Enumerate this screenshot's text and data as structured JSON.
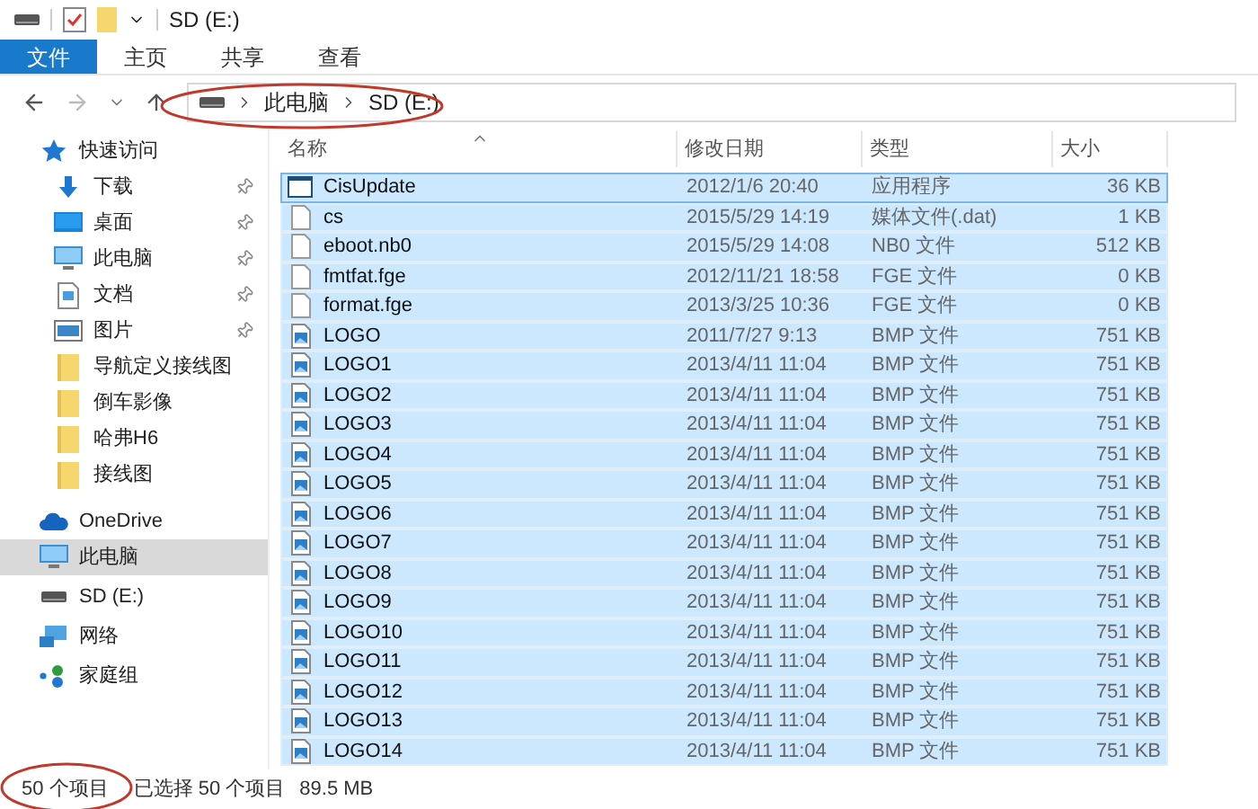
{
  "window": {
    "title": "SD (E:)"
  },
  "ribbon_tabs": [
    {
      "label": "文件",
      "selected": true
    },
    {
      "label": "主页",
      "selected": false
    },
    {
      "label": "共享",
      "selected": false
    },
    {
      "label": "查看",
      "selected": false
    }
  ],
  "address_bar": {
    "crumbs": [
      "此电脑",
      "SD (E:)"
    ]
  },
  "sidebar": {
    "items": [
      {
        "label": "快速访问",
        "kind": "star",
        "selected": false,
        "children": [
          {
            "label": "下载",
            "kind": "download",
            "pinned": true
          },
          {
            "label": "桌面",
            "kind": "desktop",
            "pinned": true
          },
          {
            "label": "此电脑",
            "kind": "computer",
            "pinned": true
          },
          {
            "label": "文档",
            "kind": "document",
            "pinned": true
          },
          {
            "label": "图片",
            "kind": "pictures",
            "pinned": true
          },
          {
            "label": "导航定义接线图",
            "kind": "folder",
            "pinned": false
          },
          {
            "label": "倒车影像",
            "kind": "folder",
            "pinned": false
          },
          {
            "label": "哈弗H6",
            "kind": "folder",
            "pinned": false
          },
          {
            "label": "接线图",
            "kind": "folder",
            "pinned": false
          }
        ]
      },
      {
        "label": "OneDrive",
        "kind": "cloud",
        "selected": false
      },
      {
        "label": "此电脑",
        "kind": "computer",
        "selected": true
      },
      {
        "label": "SD (E:)",
        "kind": "drive",
        "selected": false
      },
      {
        "label": "网络",
        "kind": "network",
        "selected": false
      },
      {
        "label": "家庭组",
        "kind": "homegroup",
        "selected": false
      }
    ]
  },
  "table": {
    "columns": [
      "名称",
      "修改日期",
      "类型",
      "大小"
    ],
    "rows": [
      {
        "name": "CisUpdate",
        "date": "2012/1/6 20:40",
        "type": "应用程序",
        "size": "36 KB",
        "kind": "app",
        "selected": true,
        "focused": true
      },
      {
        "name": "cs",
        "date": "2015/5/29 14:19",
        "type": "媒体文件(.dat)",
        "size": "1 KB",
        "kind": "file",
        "selected": true,
        "focused": false
      },
      {
        "name": "eboot.nb0",
        "date": "2015/5/29 14:08",
        "type": "NB0 文件",
        "size": "512 KB",
        "kind": "file",
        "selected": true,
        "focused": false
      },
      {
        "name": "fmtfat.fge",
        "date": "2012/11/21 18:58",
        "type": "FGE 文件",
        "size": "0 KB",
        "kind": "file",
        "selected": true,
        "focused": false
      },
      {
        "name": "format.fge",
        "date": "2013/3/25 10:36",
        "type": "FGE 文件",
        "size": "0 KB",
        "kind": "file",
        "selected": true,
        "focused": false
      },
      {
        "name": "LOGO",
        "date": "2011/7/27 9:13",
        "type": "BMP 文件",
        "size": "751 KB",
        "kind": "image",
        "selected": true,
        "focused": false
      },
      {
        "name": "LOGO1",
        "date": "2013/4/11 11:04",
        "type": "BMP 文件",
        "size": "751 KB",
        "kind": "image",
        "selected": true,
        "focused": false
      },
      {
        "name": "LOGO2",
        "date": "2013/4/11 11:04",
        "type": "BMP 文件",
        "size": "751 KB",
        "kind": "image",
        "selected": true,
        "focused": false
      },
      {
        "name": "LOGO3",
        "date": "2013/4/11 11:04",
        "type": "BMP 文件",
        "size": "751 KB",
        "kind": "image",
        "selected": true,
        "focused": false
      },
      {
        "name": "LOGO4",
        "date": "2013/4/11 11:04",
        "type": "BMP 文件",
        "size": "751 KB",
        "kind": "image",
        "selected": true,
        "focused": false
      },
      {
        "name": "LOGO5",
        "date": "2013/4/11 11:04",
        "type": "BMP 文件",
        "size": "751 KB",
        "kind": "image",
        "selected": true,
        "focused": false
      },
      {
        "name": "LOGO6",
        "date": "2013/4/11 11:04",
        "type": "BMP 文件",
        "size": "751 KB",
        "kind": "image",
        "selected": true,
        "focused": false
      },
      {
        "name": "LOGO7",
        "date": "2013/4/11 11:04",
        "type": "BMP 文件",
        "size": "751 KB",
        "kind": "image",
        "selected": true,
        "focused": false
      },
      {
        "name": "LOGO8",
        "date": "2013/4/11 11:04",
        "type": "BMP 文件",
        "size": "751 KB",
        "kind": "image",
        "selected": true,
        "focused": false
      },
      {
        "name": "LOGO9",
        "date": "2013/4/11 11:04",
        "type": "BMP 文件",
        "size": "751 KB",
        "kind": "image",
        "selected": true,
        "focused": false
      },
      {
        "name": "LOGO10",
        "date": "2013/4/11 11:04",
        "type": "BMP 文件",
        "size": "751 KB",
        "kind": "image",
        "selected": true,
        "focused": false
      },
      {
        "name": "LOGO11",
        "date": "2013/4/11 11:04",
        "type": "BMP 文件",
        "size": "751 KB",
        "kind": "image",
        "selected": true,
        "focused": false
      },
      {
        "name": "LOGO12",
        "date": "2013/4/11 11:04",
        "type": "BMP 文件",
        "size": "751 KB",
        "kind": "image",
        "selected": true,
        "focused": false
      },
      {
        "name": "LOGO13",
        "date": "2013/4/11 11:04",
        "type": "BMP 文件",
        "size": "751 KB",
        "kind": "image",
        "selected": true,
        "focused": false
      },
      {
        "name": "LOGO14",
        "date": "2013/4/11 11:04",
        "type": "BMP 文件",
        "size": "751 KB",
        "kind": "image",
        "selected": true,
        "focused": false
      }
    ]
  },
  "status_bar": {
    "count": "50 个项目",
    "selection": "已选择 50 个项目",
    "size": "89.5 MB"
  }
}
